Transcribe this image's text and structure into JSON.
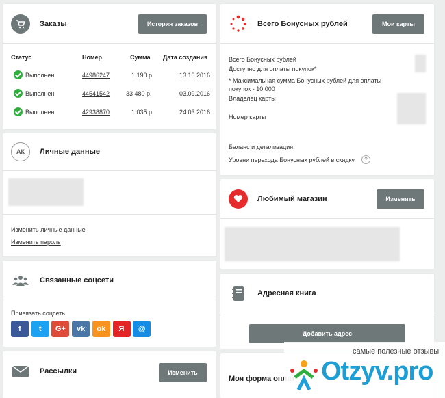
{
  "orders": {
    "title": "Заказы",
    "history_button": "История заказов",
    "columns": [
      "Статус",
      "Номер",
      "Сумма",
      "Дата создания"
    ],
    "rows": [
      {
        "status": "Выполнен",
        "number": "44986247",
        "sum": "1 190 р.",
        "date": "13.10.2016"
      },
      {
        "status": "Выполнен",
        "number": "44541542",
        "sum": "33 480 р.",
        "date": "03.09.2016"
      },
      {
        "status": "Выполнен",
        "number": "42938870",
        "sum": "1 035 р.",
        "date": "24.03.2016"
      }
    ]
  },
  "bonus": {
    "title": "Всего Бонусных рублей",
    "cards_button": "Мои карты",
    "line1": "Всего Бонусных рублей",
    "line2": "Доступно для оплаты покупок*",
    "line3": "* Максимальная сумма Бонусных рублей для оплаты",
    "line4": "покупок - 10 000",
    "line5": "Владелец карты",
    "line6": "Номер карты",
    "balance_link": "Баланс и детализация",
    "levels_link": "Уровни перехода Бонусных рублей в скидку",
    "help": "?"
  },
  "personal": {
    "avatar": "АК",
    "title": "Личные данные",
    "edit_link": "Изменить личные данные",
    "password_link": "Изменить пароль"
  },
  "favorite": {
    "title": "Любимый магазин",
    "change_button": "Изменить"
  },
  "social": {
    "title": "Связанные соцсети",
    "bind_label": "Привязать соцсеть",
    "networks": [
      {
        "name": "facebook",
        "glyph": "f",
        "color": "#3b5998"
      },
      {
        "name": "twitter",
        "glyph": "t",
        "color": "#1da1f2"
      },
      {
        "name": "google-plus",
        "glyph": "G+",
        "color": "#dd4b39"
      },
      {
        "name": "vk",
        "glyph": "vk",
        "color": "#4a76a8"
      },
      {
        "name": "odnoklassniki",
        "glyph": "ok",
        "color": "#f7931e"
      },
      {
        "name": "yandex",
        "glyph": "Я",
        "color": "#e32526"
      },
      {
        "name": "mailru",
        "glyph": "@",
        "color": "#168de2"
      }
    ]
  },
  "address": {
    "title": "Адресная книга",
    "add_button": "Добавить адрес"
  },
  "mailing": {
    "title": "Рассылки",
    "change_button": "Изменить"
  },
  "payment": {
    "title": "Моя форма оплат"
  },
  "watermark": {
    "tagline": "самые полезные отзывы",
    "brand": "Otzyv.pro"
  }
}
